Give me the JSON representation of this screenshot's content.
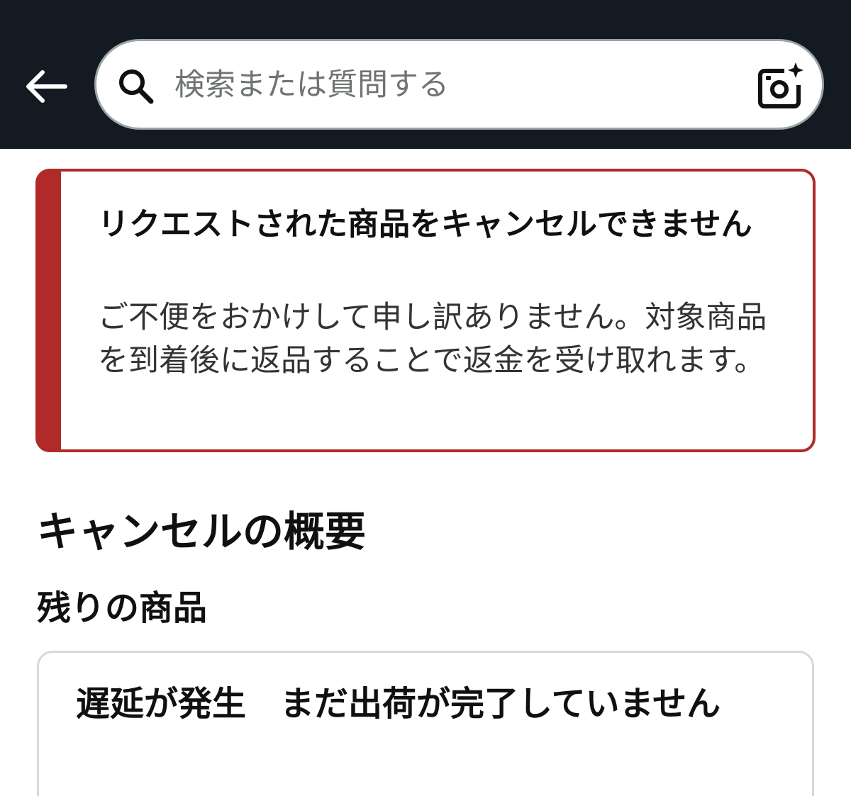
{
  "header": {
    "search_placeholder": "検索または質問する",
    "icons": {
      "back": "arrow-left-icon",
      "search": "magnifier-icon",
      "camera": "camera-sparkle-icon"
    },
    "background_color": "#131a22"
  },
  "alert": {
    "title": "リクエストされた商品をキャンセルできません",
    "message": "ご不便をおかけして申し訳ありません。対象商品を到着後に返品することで返金を受け取れます。",
    "accent_color": "#b12a2a"
  },
  "summary": {
    "title": "キャンセルの概要",
    "remaining_title": "残りの商品"
  },
  "item": {
    "status": "遅延が発生　まだ出荷が完了していません"
  }
}
